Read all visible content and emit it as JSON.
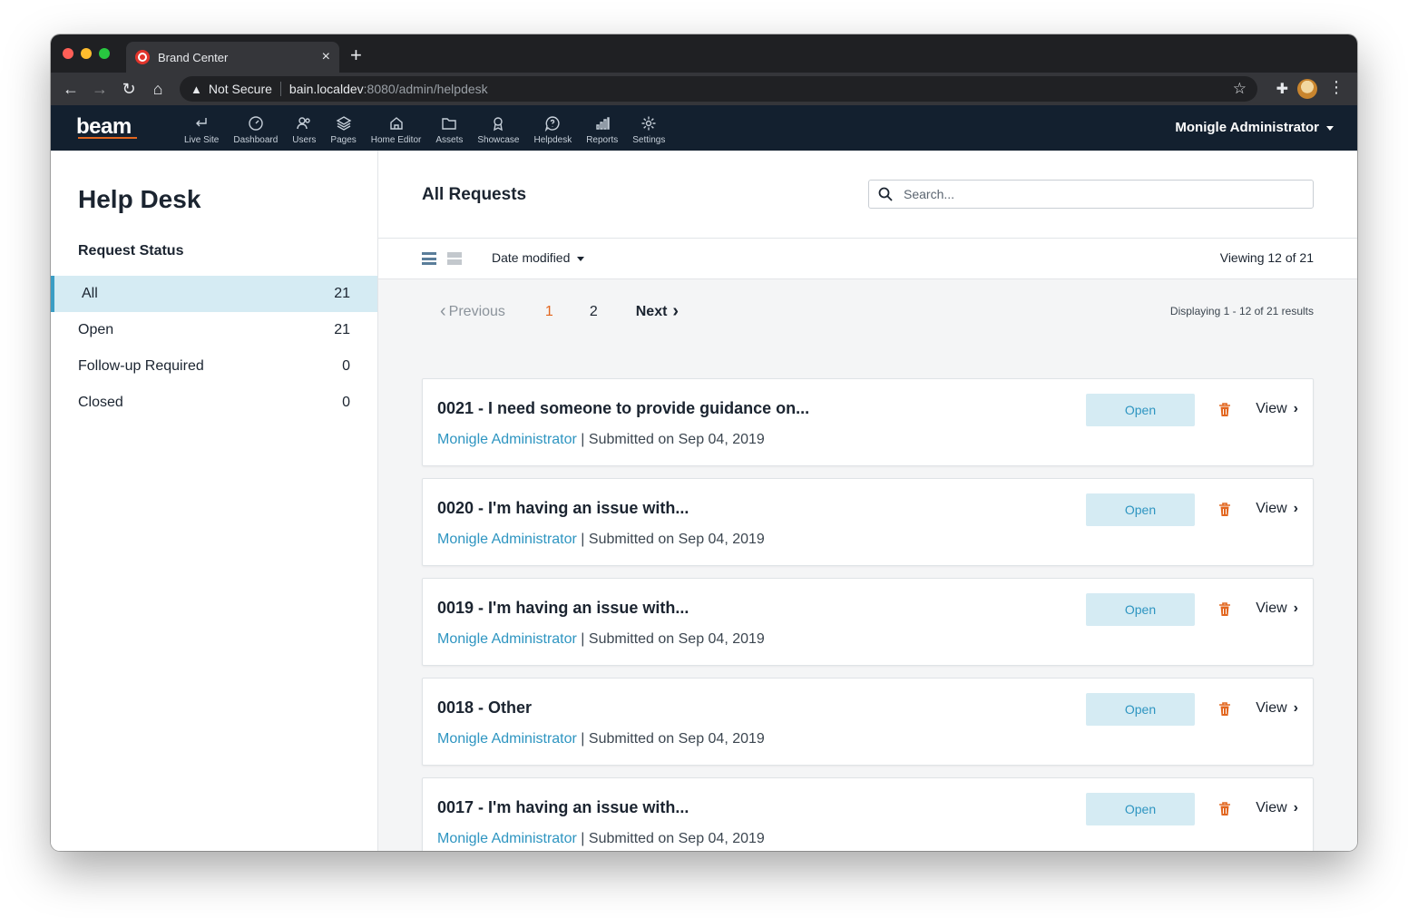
{
  "browser": {
    "tab_title": "Brand Center",
    "tab_close": "×",
    "new_tab": "+",
    "security_label": "Not Secure",
    "url_host": "bain.localdev",
    "url_path": ":8080/admin/helpdesk"
  },
  "app": {
    "logo": "beam",
    "nav": [
      {
        "label": "Live Site",
        "icon": "return-arrow-icon"
      },
      {
        "label": "Dashboard",
        "icon": "gauge-icon"
      },
      {
        "label": "Users",
        "icon": "users-icon"
      },
      {
        "label": "Pages",
        "icon": "layers-icon"
      },
      {
        "label": "Home Editor",
        "icon": "home-icon"
      },
      {
        "label": "Assets",
        "icon": "folder-icon"
      },
      {
        "label": "Showcase",
        "icon": "award-icon"
      },
      {
        "label": "Helpdesk",
        "icon": "chat-question-icon"
      },
      {
        "label": "Reports",
        "icon": "bar-chart-icon"
      },
      {
        "label": "Settings",
        "icon": "gear-icon"
      }
    ],
    "user_menu": "Monigle Administrator"
  },
  "sidebar": {
    "title": "Help Desk",
    "section": "Request Status",
    "items": [
      {
        "label": "All",
        "count": "21",
        "active": true
      },
      {
        "label": "Open",
        "count": "21"
      },
      {
        "label": "Follow-up Required",
        "count": "0"
      },
      {
        "label": "Closed",
        "count": "0"
      }
    ]
  },
  "main": {
    "title": "All Requests",
    "search_placeholder": "Search...",
    "sort_label": "Date modified",
    "viewing": "Viewing 12 of 21",
    "pager": {
      "prev": "Previous",
      "page1": "1",
      "page2": "2",
      "next": "Next",
      "displaying": "Displaying 1 - 12 of 21 results"
    },
    "requests": [
      {
        "title": "0021 - I need someone to provide guidance on...",
        "author": "Monigle Administrator",
        "submitted": " | Submitted on Sep 04, 2019",
        "status": "Open",
        "view": "View"
      },
      {
        "title": "0020 - I'm having an issue with...",
        "author": "Monigle Administrator",
        "submitted": " | Submitted on Sep 04, 2019",
        "status": "Open",
        "view": "View"
      },
      {
        "title": "0019 - I'm having an issue with...",
        "author": "Monigle Administrator",
        "submitted": " | Submitted on Sep 04, 2019",
        "status": "Open",
        "view": "View"
      },
      {
        "title": "0018 - Other",
        "author": "Monigle Administrator",
        "submitted": " | Submitted on Sep 04, 2019",
        "status": "Open",
        "view": "View"
      },
      {
        "title": "0017 - I'm having an issue with...",
        "author": "Monigle Administrator",
        "submitted": " | Submitted on Sep 04, 2019",
        "status": "Open",
        "view": "View"
      }
    ]
  },
  "colors": {
    "header_bg": "#13202f",
    "accent_blue": "#2e95c1",
    "accent_orange": "#e2661f",
    "badge_bg": "#d5ebf3"
  }
}
